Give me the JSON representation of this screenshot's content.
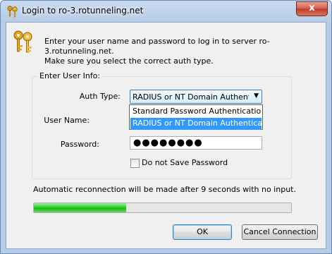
{
  "window": {
    "title": "Login to ro-3.rotunneling.net",
    "close_glyph": "x"
  },
  "intro": {
    "line1": "Enter your user name and password to log in to server ro-3.rotunneling.net.",
    "line2": "Make sure you select the correct auth type."
  },
  "group": {
    "legend": "Enter User Info:",
    "auth_type_label": "Auth Type:",
    "auth_type_selected": "RADIUS or NT Domain Authentication",
    "auth_options": [
      {
        "label": "Standard Password Authentication",
        "selected": false
      },
      {
        "label": "RADIUS or NT Domain Authentication",
        "selected": true
      }
    ],
    "user_name_label": "User Name:",
    "user_name_value": "",
    "password_label": "Password:",
    "password_value": "●●●●●●●●",
    "no_save_label": "Do not Save Password",
    "no_save_checked": false
  },
  "status": {
    "reconnect_text": "Automatic reconnection will be made after 9 seconds with no input.",
    "progress_fraction": 0.36
  },
  "buttons": {
    "ok": "OK",
    "cancel": "Cancel Connection"
  },
  "icons": {
    "title": "keys-icon",
    "header": "keys-icon"
  },
  "colors": {
    "progress": "#2ed12b",
    "selection": "#3399ff",
    "close": "#c0392b"
  }
}
